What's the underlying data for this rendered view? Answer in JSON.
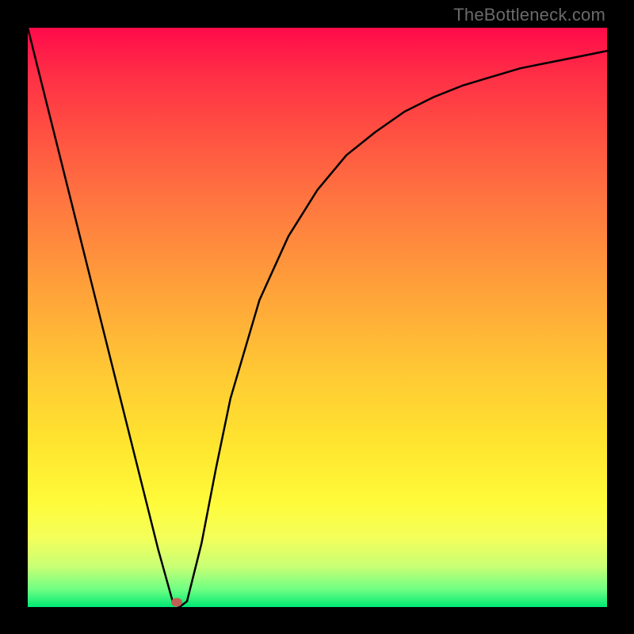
{
  "watermark": "TheBottleneck.com",
  "marker": {
    "x_frac": 0.257,
    "y_frac": 0.992
  },
  "chart_data": {
    "type": "line",
    "title": "",
    "xlabel": "",
    "ylabel": "",
    "xlim": [
      0,
      1
    ],
    "ylim": [
      0,
      1
    ],
    "series": [
      {
        "name": "curve",
        "x": [
          0.0,
          0.05,
          0.1,
          0.15,
          0.2,
          0.225,
          0.25,
          0.262,
          0.275,
          0.3,
          0.325,
          0.35,
          0.4,
          0.45,
          0.5,
          0.55,
          0.6,
          0.65,
          0.7,
          0.75,
          0.8,
          0.85,
          0.9,
          0.95,
          1.0
        ],
        "y": [
          1.0,
          0.8,
          0.6,
          0.4,
          0.2,
          0.1,
          0.01,
          0.0,
          0.01,
          0.11,
          0.24,
          0.36,
          0.53,
          0.64,
          0.72,
          0.78,
          0.82,
          0.855,
          0.88,
          0.9,
          0.915,
          0.93,
          0.94,
          0.95,
          0.96
        ]
      }
    ],
    "marker_point": {
      "x": 0.257,
      "y": 0.008
    }
  }
}
